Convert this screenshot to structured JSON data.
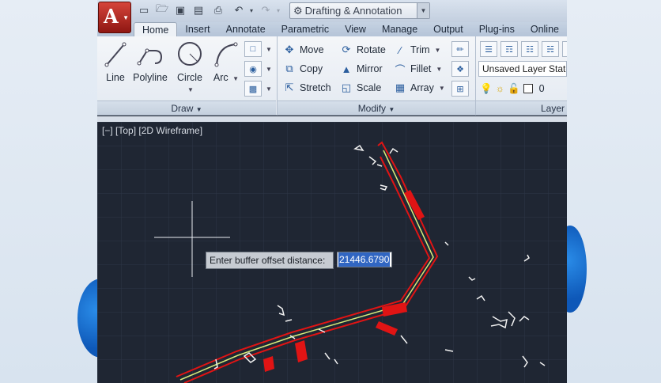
{
  "workspace": "Drafting & Annotation",
  "tabs": [
    "Home",
    "Insert",
    "Annotate",
    "Parametric",
    "View",
    "Manage",
    "Output",
    "Plug-ins",
    "Online"
  ],
  "active_tab": "Home",
  "draw_panel": {
    "title": "Draw",
    "tools": [
      "Line",
      "Polyline",
      "Circle",
      "Arc"
    ]
  },
  "modify_panel": {
    "title": "Modify",
    "tools": [
      "Move",
      "Rotate",
      "Trim",
      "Copy",
      "Mirror",
      "Fillet",
      "Stretch",
      "Scale",
      "Array"
    ]
  },
  "layers_panel": {
    "title": "Layer",
    "state": "Unsaved Layer State",
    "current_layer": "0"
  },
  "viewport": {
    "label": "[−] [Top] [2D Wireframe]"
  },
  "command_prompt": {
    "label": "Enter buffer offset distance:",
    "value": "21446.6790"
  },
  "colors": {
    "accent": "#3166c2",
    "canvas": "#1f2633",
    "buffer_line": "#e01414",
    "centerline": "#d8ec7a"
  },
  "icons": [
    "app-menu-icon",
    "new-icon",
    "open-icon",
    "save-icon",
    "save-as-icon",
    "print-icon",
    "undo-icon",
    "redo-icon",
    "gear-icon"
  ]
}
